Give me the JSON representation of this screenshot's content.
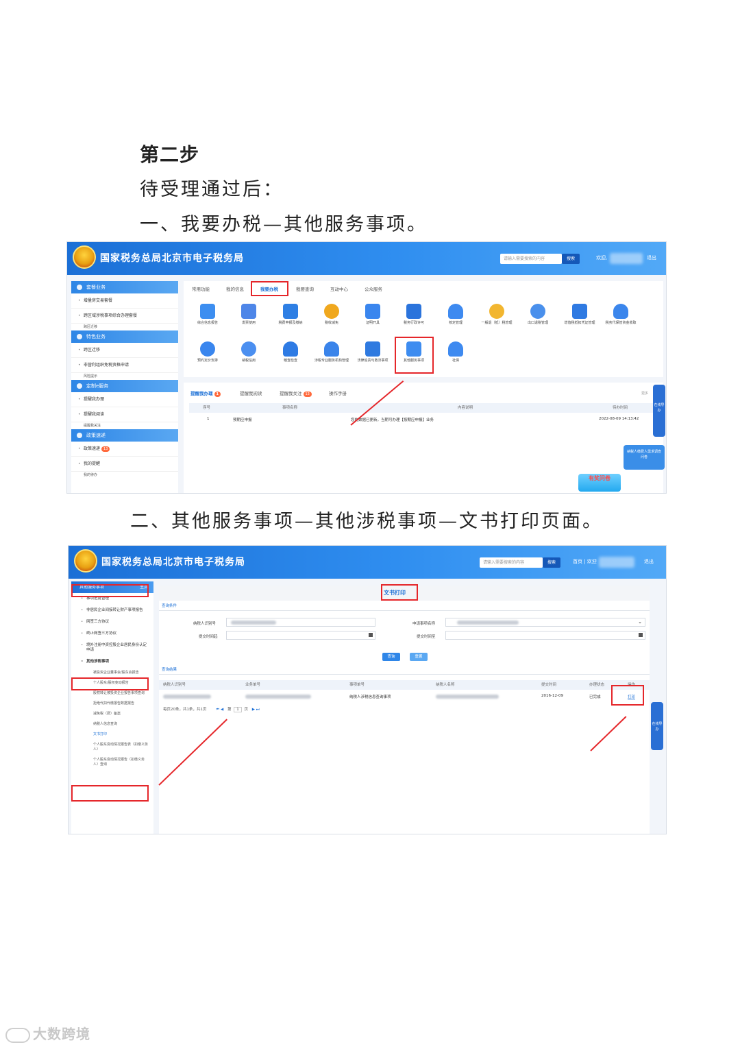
{
  "heading": "第二步",
  "lines": {
    "l1": "待受理通过后：",
    "l2": "一、我要办税—其他服务事项。",
    "l3": "二、其他服务事项—其他涉税事项—文书打印页面。"
  },
  "shot1": {
    "title": "国家税务总局北京市电子税务局",
    "search_placeholder": "请输入需要搜索的内容",
    "search_btn": "搜索",
    "welcome": "欢迎,",
    "logout": "退出",
    "sidebar": {
      "group1": "套餐业务",
      "g1_items": [
        "增量房交易套餐",
        "跨区域涉税事项综合办理套餐",
        "跨区迁移"
      ],
      "group2": "特色业务",
      "g2_items": [
        "跨区迁移",
        "非营利组织免税资格申请",
        "风险提示"
      ],
      "group3": "定制e服务",
      "g3_items": [
        "提醒我办理",
        "提醒我阅读",
        "提醒我关注"
      ],
      "group4": "政策速递",
      "g4_items": [
        "政策速递",
        "我的提醒",
        "我的待办"
      ],
      "g4_badge": "13"
    },
    "tabs": [
      "常用功能",
      "我的信息",
      "我要办税",
      "我要查询",
      "互动中心",
      "公众服务"
    ],
    "icons": [
      "综合信息报告",
      "发票使用",
      "税费申报及缴纳",
      "税收减免",
      "证明开具",
      "税务行政许可",
      "核定管理",
      "一般退（抵）税管理",
      "出口退税管理",
      "增值税抵扣凭证管理",
      "税务代保管资金收取",
      "预约定价安排",
      "纳税信用",
      "稽查检查",
      "涉税专业服务机构管理",
      "法律追责与救济事项",
      "其他服务事项",
      "社保"
    ],
    "remind_tabs": [
      "提醒我办理",
      "提醒我阅读",
      "提醒我关注",
      "操作手册"
    ],
    "remind_badge1": "1",
    "remind_badge2": "13",
    "more": "更多",
    "table_head": [
      "序号",
      "事项名称",
      "内容说明",
      "待办时间"
    ],
    "table_row": [
      "1",
      "预期应申报",
      "您的数据已更新，当期可办理【按期应申报】业务",
      "2022-08-09 14:13:42"
    ],
    "float_online": "在线导办",
    "float_survey": "纳税人缴费人需求调查问卷",
    "float_promo": "有奖问卷"
  },
  "shot2": {
    "title": "国家税务总局北京市电子税务局",
    "search_placeholder": "请输入需要搜索的内容",
    "search_btn": "搜索",
    "home_links": "首页 | 欢迎",
    "logout": "退出",
    "side_head": "其他服务事项",
    "side_home": "主页",
    "side_items": [
      "事项进度管理",
      "非居民企业间接转让财产事项报告",
      "网签三方协议",
      "终止网签三方协议",
      "境外注册中资控股企业居民身份认定申请",
      "其他涉税事项"
    ],
    "side_subs": [
      "被投资企业董事会/股东会报告",
      "个人股东/股权变动报告",
      "股权转让被投资企业报告事项查询",
      "拒绝代扣代缴报告数据报告",
      "减免税（费）备案",
      "纳税人信息查询",
      "文书打印",
      "个人股东变动情况报告表（扣缴义务人）",
      "个人股东变动情况报告（扣缴义务人）查询"
    ],
    "page_title": "文书打印",
    "query_cond": "查询条件",
    "field_taxid": "纳税人识别号",
    "field_item_name": "申请事项名称",
    "field_time_from": "提交时间起",
    "field_time_to": "提交时间至",
    "btn_query": "查询",
    "btn_reset": "重置",
    "query_result": "查询结果",
    "cols": [
      "纳税人识别号",
      "业务单号",
      "事项单号",
      "纳税人名称",
      "提交时间",
      "办理状态",
      "操作"
    ],
    "row": [
      "纳税人涉税信息查询事项",
      "2016-12-09",
      "已完成",
      "打印"
    ],
    "pager": "每页20条，共1条，共1页",
    "pager_page": "第",
    "pager_num": "1",
    "pager_unit": "页",
    "float_online": "在线导办"
  },
  "watermark": "大数跨境",
  "colors": {
    "brand_blue": "#2f8ef0",
    "highlight_red": "#e5262a"
  }
}
